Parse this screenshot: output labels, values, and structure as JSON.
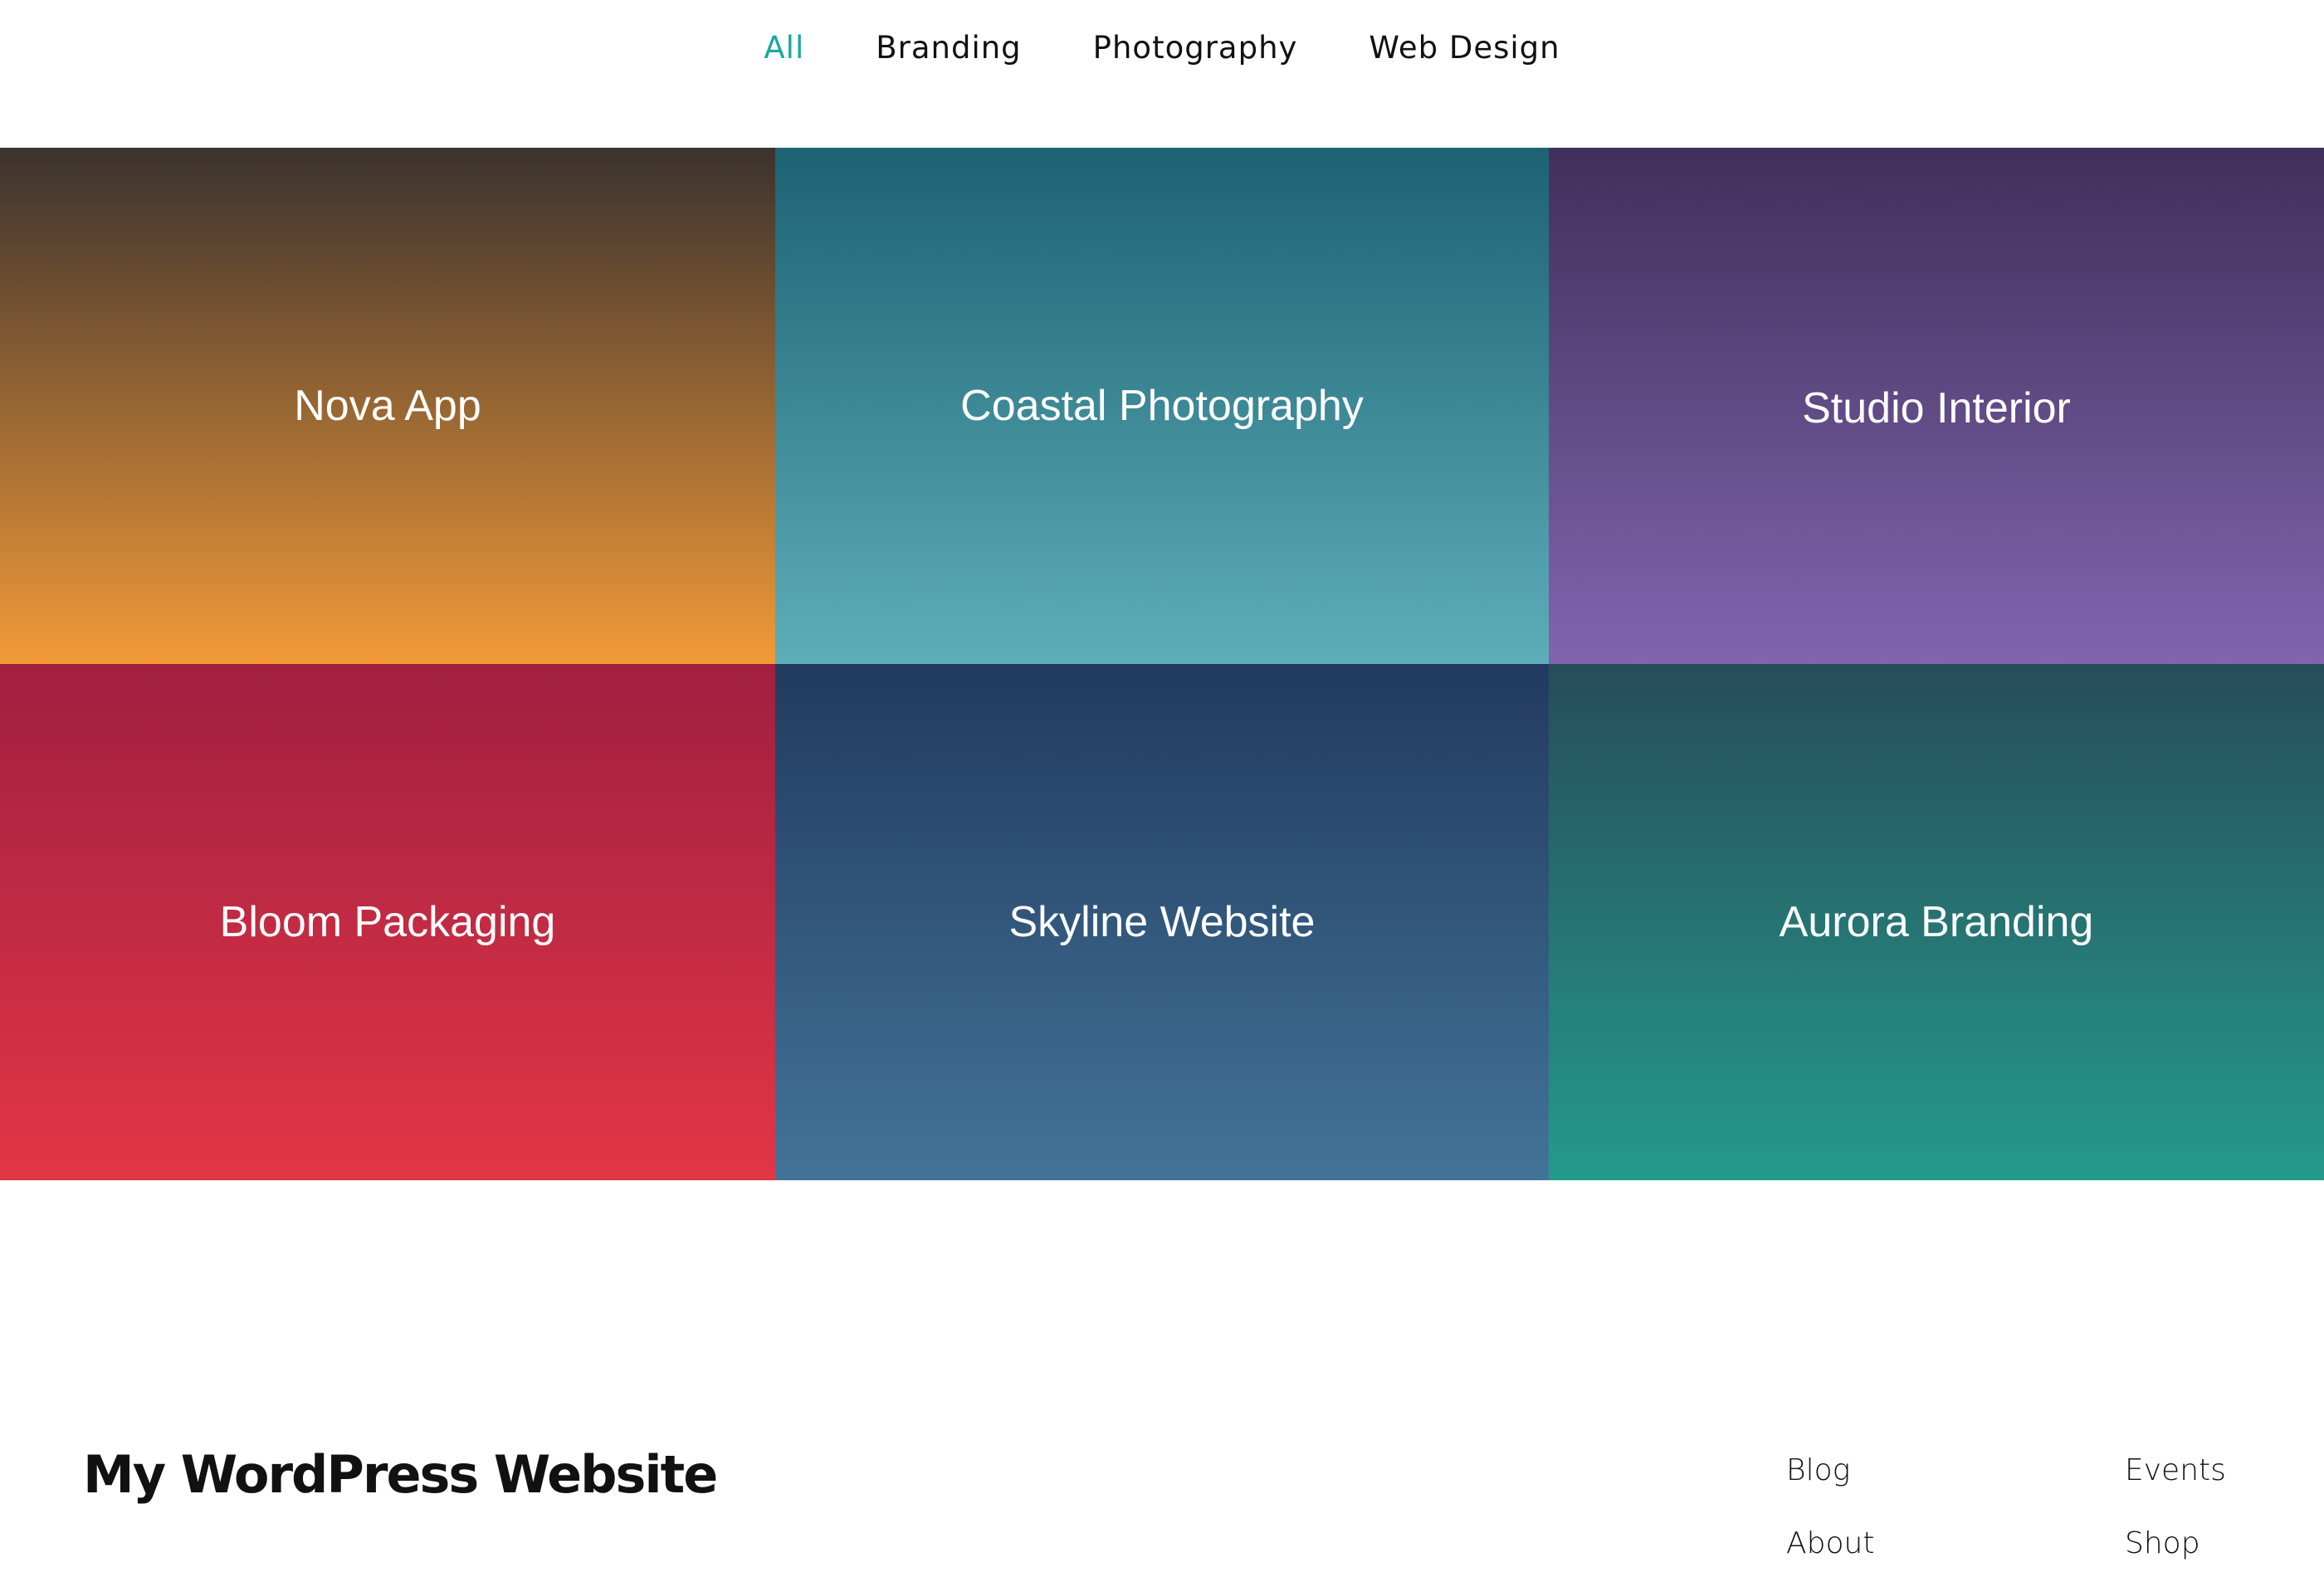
{
  "filters": {
    "items": [
      "All",
      "Branding",
      "Photography",
      "Web Design"
    ],
    "active_color": "#1aa89c"
  },
  "portfolio": {
    "tiles": [
      {
        "title": "Nova App",
        "gradient": [
          "#3b322e",
          "#f29a37"
        ]
      },
      {
        "title": "Coastal Photography",
        "gradient": [
          "#1d6273",
          "#5daeb8"
        ]
      },
      {
        "title": "Studio Interior",
        "gradient": [
          "#40305a",
          "#8065af"
        ]
      },
      {
        "title": "Bloom Packaging",
        "gradient": [
          "#a11f40",
          "#e23646"
        ]
      },
      {
        "title": "Skyline Website",
        "gradient": [
          "#223a5f",
          "#427498"
        ]
      },
      {
        "title": "Aurora Branding",
        "gradient": [
          "#264d59",
          "#259a8c"
        ]
      }
    ]
  },
  "footer": {
    "site_title": "My WordPress Website",
    "nav": [
      "Blog",
      "Events",
      "About",
      "Shop"
    ]
  }
}
